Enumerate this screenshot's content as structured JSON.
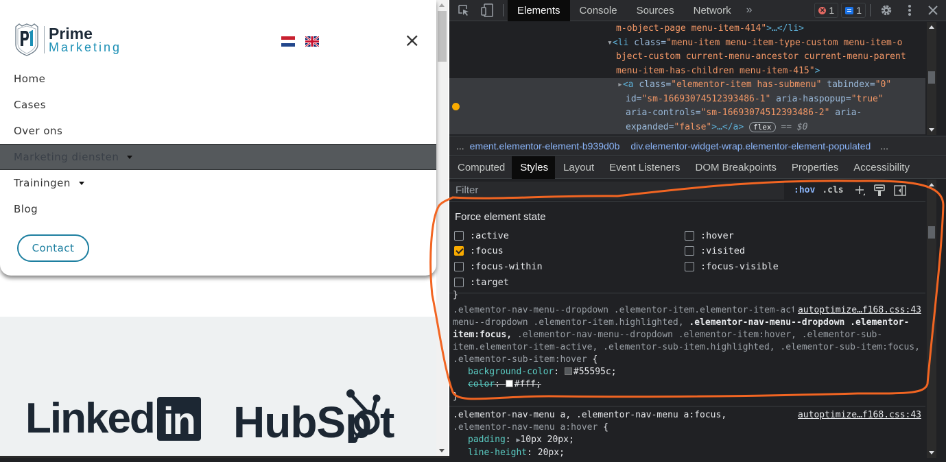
{
  "page": {
    "logo": {
      "line1": "Prime",
      "line2": "Marketing",
      "mark": "PM"
    },
    "languages": [
      {
        "code": "nl",
        "name": "Nederlands"
      },
      {
        "code": "en",
        "name": "English"
      }
    ],
    "close_icon": "×",
    "nav_items": [
      {
        "label": "Home",
        "has_submenu": false,
        "active": false
      },
      {
        "label": "Cases",
        "has_submenu": false,
        "active": false
      },
      {
        "label": "Over ons",
        "has_submenu": false,
        "active": false
      },
      {
        "label": "Marketing diensten",
        "has_submenu": true,
        "active": true
      },
      {
        "label": "Trainingen",
        "has_submenu": true,
        "active": false
      },
      {
        "label": "Blog",
        "has_submenu": false,
        "active": false
      }
    ],
    "contact_label": "Contact",
    "partner_logos": [
      {
        "name": "LinkedIn",
        "text": "Linked",
        "box": "in"
      },
      {
        "name": "HubSpot",
        "text": "HubSpot"
      }
    ],
    "colors": {
      "active_bg": "#55595c",
      "brand_blue": "#1d7fa0",
      "brand_dark": "#1c2733"
    }
  },
  "devtools": {
    "tabs": [
      {
        "label": "Elements",
        "active": true
      },
      {
        "label": "Console",
        "active": false
      },
      {
        "label": "Sources",
        "active": false
      },
      {
        "label": "Network",
        "active": false
      }
    ],
    "more_tabs": "»",
    "error_count": "1",
    "message_count": "1",
    "dom": {
      "line1": {
        "val": "m-object-page menu-item-414\"",
        "rest": ">…</li>"
      },
      "line2": {
        "open": "<li ",
        "attr": "class=",
        "val": "\"menu-item menu-item-type-custom menu-item-o"
      },
      "line3": {
        "val": "bject-custom current-menu-ancestor current-menu-parent"
      },
      "line4": {
        "val": "menu-item-has-children menu-item-415\"",
        "rest": ">"
      },
      "sel1": {
        "open": "<a ",
        "attr1": "class=",
        "val1": "\"elementor-item has-submenu\"",
        "attr2": " tabindex=",
        "val2": "\"0\""
      },
      "sel2": {
        "attr1": "id=",
        "val1": "\"sm-16693074512393486-1\"",
        "attr2": " aria-haspopup=",
        "val2": "\"true\""
      },
      "sel3": {
        "attr1": "aria-controls=",
        "val1": "\"sm-16693074512393486-2\"",
        "attr2": " aria-"
      },
      "sel4": {
        "attr1": "expanded=",
        "val1": "\"false\"",
        "rest": ">…</a>",
        "pill": "flex",
        "eq": " == $0"
      }
    },
    "breadcrumb": {
      "ellipsis_left": "...",
      "items": [
        "ement.elementor-element-b939d0b",
        "div.elementor-widget-wrap.elementor-element-populated"
      ],
      "ellipsis_right": "..."
    },
    "sub_tabs": [
      {
        "label": "Computed",
        "active": false
      },
      {
        "label": "Styles",
        "active": true
      },
      {
        "label": "Layout",
        "active": false
      },
      {
        "label": "Event Listeners",
        "active": false
      },
      {
        "label": "DOM Breakpoints",
        "active": false
      },
      {
        "label": "Properties",
        "active": false
      },
      {
        "label": "Accessibility",
        "active": false
      }
    ],
    "filter_placeholder": "Filter",
    "hov_label": ":hov",
    "cls_label": ".cls",
    "force_state": {
      "title": "Force element state",
      "states": [
        {
          "label": ":active",
          "checked": false
        },
        {
          "label": ":hover",
          "checked": false
        },
        {
          "label": ":focus",
          "checked": true
        },
        {
          "label": ":visited",
          "checked": false
        },
        {
          "label": ":focus-within",
          "checked": false
        },
        {
          "label": ":focus-visible",
          "checked": false
        },
        {
          "label": ":target",
          "checked": false
        }
      ]
    },
    "rules": [
      {
        "selector_parts": [
          {
            "text": ".elementor-nav-menu--dropdown .elementor-item.elementor-item-active, .elementor-nav-menu--dropdown .elementor-item.highlighted, ",
            "match": false
          },
          {
            "text": ".elementor-nav-menu--dropdown .elementor-item:focus,",
            "match": true
          },
          {
            "text": " .elementor-nav-menu--dropdown .elementor-item:hover, .elementor-sub-item.elementor-item-active, .elementor-sub-item.highlighted, .elementor-sub-item:focus, .elementor-sub-item:hover ",
            "match": false
          }
        ],
        "source": "autoptimize…f168.css:43",
        "declarations": [
          {
            "name": "background-color",
            "value": "#55595c",
            "swatch": "#55595c",
            "struck": false
          },
          {
            "name": "color",
            "value": "#fff",
            "swatch": "#ffffff",
            "struck": true
          }
        ]
      },
      {
        "selector_parts": [
          {
            "text": ".elementor-nav-menu a, .elementor-nav-menu a:focus,",
            "match": true
          },
          {
            "text": " .elementor-nav-menu a:hover ",
            "match": false
          }
        ],
        "source": "autoptimize…f168.css:43",
        "declarations": [
          {
            "name": "padding",
            "value": "10px 20px",
            "struck": false,
            "expandable": true
          },
          {
            "name": "line-height",
            "value": "20px",
            "struck": false
          }
        ]
      }
    ]
  }
}
